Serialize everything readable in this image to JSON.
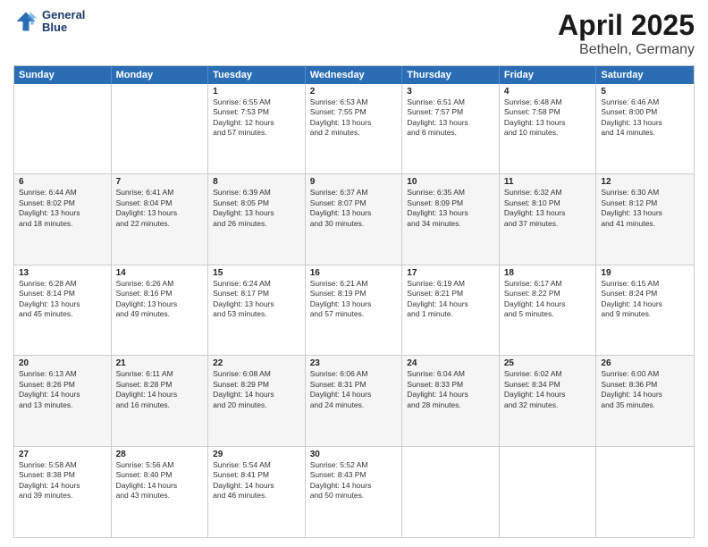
{
  "logo": {
    "line1": "General",
    "line2": "Blue"
  },
  "title": "April 2025",
  "subtitle": "Betheln, Germany",
  "days": [
    "Sunday",
    "Monday",
    "Tuesday",
    "Wednesday",
    "Thursday",
    "Friday",
    "Saturday"
  ],
  "weeks": [
    [
      {
        "day": "",
        "info": ""
      },
      {
        "day": "",
        "info": ""
      },
      {
        "day": "1",
        "info": "Sunrise: 6:55 AM\nSunset: 7:53 PM\nDaylight: 12 hours\nand 57 minutes."
      },
      {
        "day": "2",
        "info": "Sunrise: 6:53 AM\nSunset: 7:55 PM\nDaylight: 13 hours\nand 2 minutes."
      },
      {
        "day": "3",
        "info": "Sunrise: 6:51 AM\nSunset: 7:57 PM\nDaylight: 13 hours\nand 6 minutes."
      },
      {
        "day": "4",
        "info": "Sunrise: 6:48 AM\nSunset: 7:58 PM\nDaylight: 13 hours\nand 10 minutes."
      },
      {
        "day": "5",
        "info": "Sunrise: 6:46 AM\nSunset: 8:00 PM\nDaylight: 13 hours\nand 14 minutes."
      }
    ],
    [
      {
        "day": "6",
        "info": "Sunrise: 6:44 AM\nSunset: 8:02 PM\nDaylight: 13 hours\nand 18 minutes."
      },
      {
        "day": "7",
        "info": "Sunrise: 6:41 AM\nSunset: 8:04 PM\nDaylight: 13 hours\nand 22 minutes."
      },
      {
        "day": "8",
        "info": "Sunrise: 6:39 AM\nSunset: 8:05 PM\nDaylight: 13 hours\nand 26 minutes."
      },
      {
        "day": "9",
        "info": "Sunrise: 6:37 AM\nSunset: 8:07 PM\nDaylight: 13 hours\nand 30 minutes."
      },
      {
        "day": "10",
        "info": "Sunrise: 6:35 AM\nSunset: 8:09 PM\nDaylight: 13 hours\nand 34 minutes."
      },
      {
        "day": "11",
        "info": "Sunrise: 6:32 AM\nSunset: 8:10 PM\nDaylight: 13 hours\nand 37 minutes."
      },
      {
        "day": "12",
        "info": "Sunrise: 6:30 AM\nSunset: 8:12 PM\nDaylight: 13 hours\nand 41 minutes."
      }
    ],
    [
      {
        "day": "13",
        "info": "Sunrise: 6:28 AM\nSunset: 8:14 PM\nDaylight: 13 hours\nand 45 minutes."
      },
      {
        "day": "14",
        "info": "Sunrise: 6:26 AM\nSunset: 8:16 PM\nDaylight: 13 hours\nand 49 minutes."
      },
      {
        "day": "15",
        "info": "Sunrise: 6:24 AM\nSunset: 8:17 PM\nDaylight: 13 hours\nand 53 minutes."
      },
      {
        "day": "16",
        "info": "Sunrise: 6:21 AM\nSunset: 8:19 PM\nDaylight: 13 hours\nand 57 minutes."
      },
      {
        "day": "17",
        "info": "Sunrise: 6:19 AM\nSunset: 8:21 PM\nDaylight: 14 hours\nand 1 minute."
      },
      {
        "day": "18",
        "info": "Sunrise: 6:17 AM\nSunset: 8:22 PM\nDaylight: 14 hours\nand 5 minutes."
      },
      {
        "day": "19",
        "info": "Sunrise: 6:15 AM\nSunset: 8:24 PM\nDaylight: 14 hours\nand 9 minutes."
      }
    ],
    [
      {
        "day": "20",
        "info": "Sunrise: 6:13 AM\nSunset: 8:26 PM\nDaylight: 14 hours\nand 13 minutes."
      },
      {
        "day": "21",
        "info": "Sunrise: 6:11 AM\nSunset: 8:28 PM\nDaylight: 14 hours\nand 16 minutes."
      },
      {
        "day": "22",
        "info": "Sunrise: 6:08 AM\nSunset: 8:29 PM\nDaylight: 14 hours\nand 20 minutes."
      },
      {
        "day": "23",
        "info": "Sunrise: 6:06 AM\nSunset: 8:31 PM\nDaylight: 14 hours\nand 24 minutes."
      },
      {
        "day": "24",
        "info": "Sunrise: 6:04 AM\nSunset: 8:33 PM\nDaylight: 14 hours\nand 28 minutes."
      },
      {
        "day": "25",
        "info": "Sunrise: 6:02 AM\nSunset: 8:34 PM\nDaylight: 14 hours\nand 32 minutes."
      },
      {
        "day": "26",
        "info": "Sunrise: 6:00 AM\nSunset: 8:36 PM\nDaylight: 14 hours\nand 35 minutes."
      }
    ],
    [
      {
        "day": "27",
        "info": "Sunrise: 5:58 AM\nSunset: 8:38 PM\nDaylight: 14 hours\nand 39 minutes."
      },
      {
        "day": "28",
        "info": "Sunrise: 5:56 AM\nSunset: 8:40 PM\nDaylight: 14 hours\nand 43 minutes."
      },
      {
        "day": "29",
        "info": "Sunrise: 5:54 AM\nSunset: 8:41 PM\nDaylight: 14 hours\nand 46 minutes."
      },
      {
        "day": "30",
        "info": "Sunrise: 5:52 AM\nSunset: 8:43 PM\nDaylight: 14 hours\nand 50 minutes."
      },
      {
        "day": "",
        "info": ""
      },
      {
        "day": "",
        "info": ""
      },
      {
        "day": "",
        "info": ""
      }
    ]
  ]
}
